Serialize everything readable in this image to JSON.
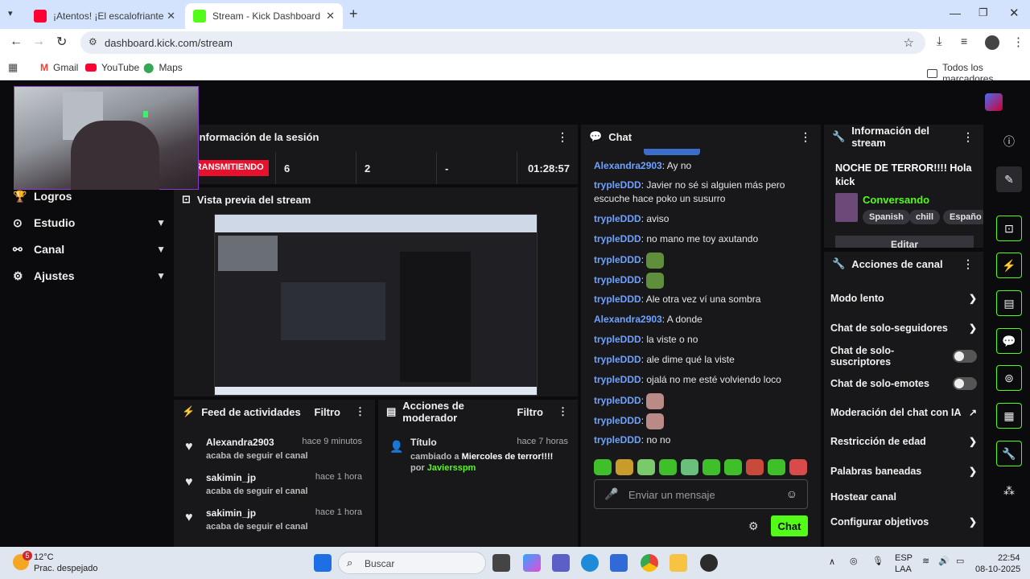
{
  "browser": {
    "tabs": [
      {
        "title": "¡Atentos! ¡El escalofriante video",
        "favicon_color": "#ff0033",
        "active": false
      },
      {
        "title": "Stream - Kick Dashboard",
        "favicon_color": "#53fc18",
        "active": true
      }
    ],
    "new_tab": "+",
    "url": "dashboard.kick.com/stream",
    "bookmarks": [
      "Gmail",
      "YouTube",
      "Maps"
    ],
    "all_bookmarks": "Todos los marcadores"
  },
  "sidebar": {
    "items": [
      {
        "label": "Logros",
        "icon": "trophy-icon",
        "has_chevron": false
      },
      {
        "label": "Estudio",
        "icon": "studio-icon",
        "has_chevron": true
      },
      {
        "label": "Canal",
        "icon": "channel-icon",
        "has_chevron": true
      },
      {
        "label": "Ajustes",
        "icon": "gear-icon",
        "has_chevron": true
      }
    ]
  },
  "session": {
    "title": "Información de la sesión",
    "status": "TRANSMITIENDO",
    "stats": [
      "6",
      "2",
      "-"
    ],
    "duration": "01:28:57"
  },
  "preview": {
    "title": "Vista previa del stream"
  },
  "activity": {
    "title": "Feed de actividades",
    "filter": "Filtro",
    "rows": [
      {
        "name": "Alexandra2903",
        "time": "hace 9 minutos",
        "sub": "acaba de seguir el canal"
      },
      {
        "name": "sakimin_jp",
        "time": "hace 1 hora",
        "sub": "acaba de seguir el canal"
      },
      {
        "name": "sakimin_jp",
        "time": "hace 1 hora",
        "sub": "acaba de seguir el canal"
      }
    ]
  },
  "moderator": {
    "title": "Acciones de moderador",
    "filter": "Filtro",
    "entry": {
      "label": "Título",
      "time": "hace 7 horas",
      "changed": "cambiado a",
      "value": "Miercoles de terror!!!!",
      "by": "por",
      "user": "Javiersspm"
    }
  },
  "chat": {
    "title": "Chat",
    "messages": [
      {
        "user": "Alexandra2903",
        "text": ": Ay no",
        "emote": false
      },
      {
        "user": "trypleDDD",
        "text": ": Javier no sé si alguien más pero escuche hace poko un susurro",
        "emote": false
      },
      {
        "user": "trypleDDD",
        "text": ": aviso",
        "emote": false
      },
      {
        "user": "trypleDDD",
        "text": ": no mano me toy axutando",
        "emote": false
      },
      {
        "user": "trypleDDD",
        "text": ":",
        "emote": true
      },
      {
        "user": "trypleDDD",
        "text": ":",
        "emote": true
      },
      {
        "user": "trypleDDD",
        "text": ": Ale otra vez ví una sombra",
        "emote": false
      },
      {
        "user": "Alexandra2903",
        "text": ": A donde",
        "emote": false
      },
      {
        "user": "trypleDDD",
        "text": ": la viste o no",
        "emote": false
      },
      {
        "user": "trypleDDD",
        "text": ": ale dime qué la viste",
        "emote": false
      },
      {
        "user": "trypleDDD",
        "text": ": ojalá no me esté volviendo loco",
        "emote": false
      },
      {
        "user": "trypleDDD",
        "text": ":",
        "emote": true
      },
      {
        "user": "trypleDDD",
        "text": ":",
        "emote": true
      },
      {
        "user": "trypleDDD",
        "text": ": no no",
        "emote": false
      }
    ],
    "input_placeholder": "Enviar un mensaje",
    "send_label": "Chat"
  },
  "stream_info": {
    "title": "Información del stream",
    "stream_title": "NOCHE DE TERROR!!!! Hola kick",
    "category": "Conversando",
    "tags": [
      "Spanish",
      "chill",
      "Españo"
    ],
    "edit_label": "Editar"
  },
  "channel_actions": {
    "title": "Acciones de canal",
    "items": [
      {
        "label": "Modo lento",
        "control": "chevron"
      },
      {
        "label": "Chat de solo-seguidores",
        "control": "chevron"
      },
      {
        "label": "Chat de solo-suscriptores",
        "control": "toggle"
      },
      {
        "label": "Chat de solo-emotes",
        "control": "toggle"
      },
      {
        "label": "Moderación del chat con IA",
        "control": "external"
      },
      {
        "label": "Restricción de edad",
        "control": "chevron"
      },
      {
        "label": "Palabras baneadas",
        "control": "chevron"
      },
      {
        "label": "Hostear canal",
        "control": "none"
      },
      {
        "label": "Configurar objetivos",
        "control": "chevron"
      }
    ]
  },
  "taskbar": {
    "temp": "12°C",
    "weather": "Prac. despejado",
    "search": "Buscar",
    "lang": "ESP",
    "region": "LAA",
    "time": "22:54",
    "date": "08-10-2025",
    "weather_badge": "5"
  },
  "colors": {
    "accent": "#53fc18",
    "live": "#e8112d",
    "user": "#6ea2ff"
  }
}
